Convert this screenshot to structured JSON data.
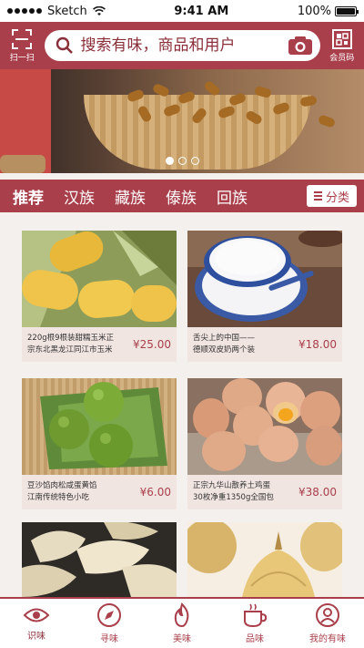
{
  "status_bar": {
    "carrier": "Sketch",
    "time": "9:41 AM",
    "battery": "100%"
  },
  "header": {
    "scan_label": "扫一扫",
    "search_placeholder": "搜索有味，商品和用户",
    "member_label": "会员码",
    "accent_color": "#a93f4b"
  },
  "banner": {
    "pages": 3,
    "active_page": 1
  },
  "tabs": {
    "items": [
      "推荐",
      "汉族",
      "藏族",
      "傣族",
      "回族"
    ],
    "active": "推荐",
    "category_label": "分类"
  },
  "products": [
    {
      "line1": "220g根9根装甜糯玉米正",
      "line2": "宗东北黑龙江同江市玉米",
      "price": "¥25.00"
    },
    {
      "line1": "舌尖上的中国——",
      "line2": "德顺双皮奶两个装",
      "price": "¥18.00"
    },
    {
      "line1": "豆沙馅肉松咸蛋黄馅",
      "line2": "江南传统特色小吃",
      "price": "¥6.00"
    },
    {
      "line1": "正宗九华山散养土鸡蛋",
      "line2": "30枚净重1350g全国包",
      "price": "¥38.00"
    }
  ],
  "tabbar": {
    "items": [
      {
        "label": "识味",
        "icon": "eye-icon"
      },
      {
        "label": "寻味",
        "icon": "compass-icon"
      },
      {
        "label": "美味",
        "icon": "flame-icon"
      },
      {
        "label": "品味",
        "icon": "cup-icon"
      },
      {
        "label": "我的有味",
        "icon": "user-icon"
      }
    ],
    "active": "识味"
  }
}
